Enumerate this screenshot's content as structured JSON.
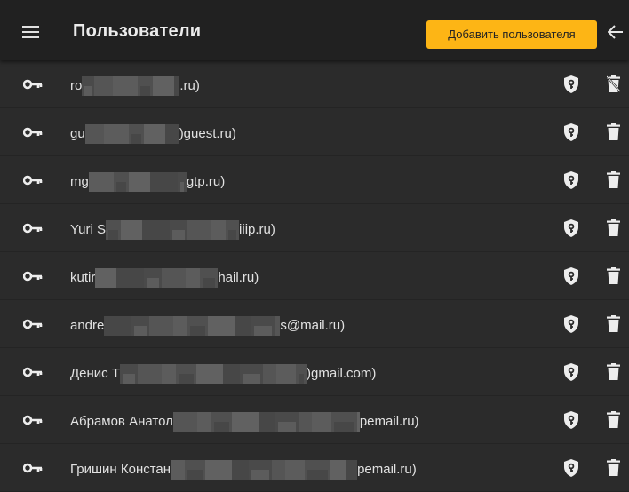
{
  "header": {
    "title": "Пользователи",
    "add_user_label": "Добавить пользователя"
  },
  "colors": {
    "accent": "#fdb515",
    "background": "#2b2b2b",
    "topbar": "#212121"
  },
  "icons": {
    "menu": "menu-icon",
    "back": "arrow-left-icon",
    "key": "key-icon",
    "shield": "shield-key-icon",
    "trash": "trash-icon",
    "trash_disabled": "trash-off-icon"
  },
  "users": [
    {
      "prefix": "ro",
      "suffix": ".ru)",
      "delete_disabled": true
    },
    {
      "prefix": "gu",
      "suffix": ")guest.ru)",
      "delete_disabled": false
    },
    {
      "prefix": "mg",
      "suffix": "gtp.ru)",
      "delete_disabled": false
    },
    {
      "prefix": "Yuri S",
      "suffix": "iiip.ru)",
      "delete_disabled": false
    },
    {
      "prefix": "kutir",
      "suffix": "hail.ru)",
      "delete_disabled": false
    },
    {
      "prefix": "andre",
      "suffix": "s@mail.ru)",
      "delete_disabled": false
    },
    {
      "prefix": "Денис Т",
      "suffix": ")gmail.com)",
      "delete_disabled": false
    },
    {
      "prefix": "Абрамов Анатол",
      "suffix": "pemail.ru)",
      "delete_disabled": false
    },
    {
      "prefix": "Гришин Констан",
      "suffix": "pemail.ru)",
      "delete_disabled": false
    }
  ]
}
